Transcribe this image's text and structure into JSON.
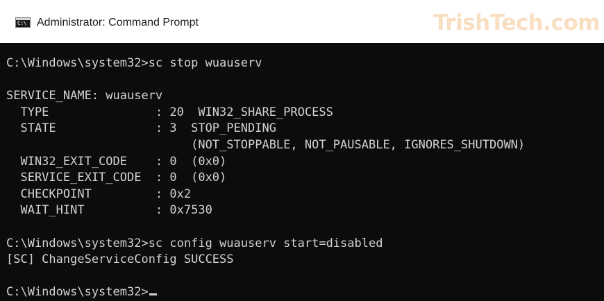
{
  "window": {
    "title": "Administrator: Command Prompt",
    "icon": "command-prompt-icon",
    "icon_glyph": "C:\\"
  },
  "watermark": "TrishTech.com",
  "console": {
    "lines": [
      "C:\\Windows\\system32>sc stop wuauserv",
      "",
      "SERVICE_NAME: wuauserv",
      "  TYPE               : 20  WIN32_SHARE_PROCESS",
      "  STATE              : 3  STOP_PENDING",
      "                          (NOT_STOPPABLE, NOT_PAUSABLE, IGNORES_SHUTDOWN)",
      "  WIN32_EXIT_CODE    : 0  (0x0)",
      "  SERVICE_EXIT_CODE  : 0  (0x0)",
      "  CHECKPOINT         : 0x2",
      "  WAIT_HINT          : 0x7530",
      "",
      "C:\\Windows\\system32>sc config wuauserv start=disabled",
      "[SC] ChangeServiceConfig SUCCESS",
      "",
      "C:\\Windows\\system32>"
    ]
  },
  "colors": {
    "console_background": "#0c0c0c",
    "console_text": "#d3d3d3",
    "titlebar_background": "#ffffff",
    "watermark": "#f9dfc2"
  }
}
